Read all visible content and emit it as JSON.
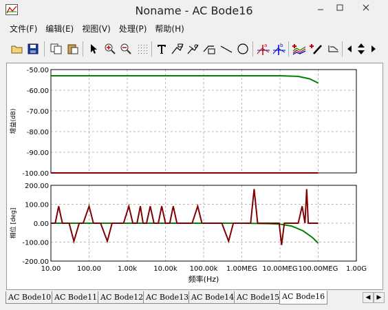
{
  "window": {
    "title": "Noname - AC Bode16"
  },
  "menu": [
    {
      "label": "文件(F)"
    },
    {
      "label": "编辑(E)"
    },
    {
      "label": "视图(V)"
    },
    {
      "label": "处理(P)"
    },
    {
      "label": "帮助(H)"
    }
  ],
  "toolbar": {
    "icons": [
      "open-icon",
      "save-icon",
      "copy-icon",
      "paste-icon",
      "pointer-icon",
      "zoom-in-icon",
      "zoom-out-icon",
      "grid-icon",
      "text-icon",
      "annotate-icon",
      "annotate-arrow-icon",
      "annotate-box-icon",
      "line-icon",
      "ellipse-icon",
      "cursor-a-icon",
      "cursor-b-icon",
      "add-trace-icon",
      "probe-icon",
      "legend-icon",
      "scroll-left-icon",
      "scroll-updown-icon",
      "scroll-right-icon"
    ]
  },
  "chart_data": [
    {
      "type": "line",
      "title": "",
      "xlabel": "",
      "ylabel": "增益(dB)",
      "xscale": "log",
      "xlim": [
        10,
        1000000000
      ],
      "ylim": [
        -100,
        -50
      ],
      "yticks": [
        "-50.00",
        "-60.00",
        "-70.00",
        "-80.00",
        "-90.00",
        "-100.00"
      ],
      "grid": true,
      "series": [
        {
          "color": "#008000",
          "x": [
            10,
            1000000,
            10000000,
            30000000,
            60000000,
            100000000
          ],
          "y": [
            -53,
            -53,
            -53,
            -53.3,
            -54.5,
            -56.5
          ]
        },
        {
          "color": "#800000",
          "x": [
            10,
            100000000
          ],
          "y": [
            -100,
            -100
          ]
        }
      ]
    },
    {
      "type": "line",
      "title": "",
      "xlabel": "频率(Hz)",
      "ylabel": "相位 [deg]",
      "xscale": "log",
      "xlim": [
        10,
        1000000000
      ],
      "ylim": [
        -200,
        200
      ],
      "yticks": [
        "200.00",
        "100.00",
        "0.00",
        "-100.00",
        "-200.00"
      ],
      "xticks": [
        "10.00",
        "100.00",
        "1.00k",
        "10.00k",
        "100.00k",
        "1.00MEG",
        "10.00MEG",
        "100.00MEG",
        "1.00G"
      ],
      "grid": true,
      "series": [
        {
          "color": "#008000",
          "x": [
            10,
            1000000,
            5000000,
            10000000,
            20000000,
            40000000,
            70000000,
            100000000
          ],
          "y": [
            0,
            0,
            -2,
            -5,
            -15,
            -40,
            -75,
            -105
          ]
        },
        {
          "color": "#800000",
          "x": [
            10,
            13,
            16,
            20,
            30,
            40,
            55,
            70,
            100,
            130,
            200,
            300,
            400,
            600,
            800,
            1100,
            1400,
            1800,
            2200,
            2600,
            3200,
            4000,
            5000,
            6500,
            8000,
            10000,
            13000,
            16000,
            20000,
            50000,
            70000,
            90000,
            120000,
            200000,
            300000,
            450000,
            600000,
            1000000,
            1700000,
            2100000,
            2600000,
            4000000,
            7000000,
            9500000,
            11000000,
            13000000,
            15000000,
            25000000,
            30000000,
            38000000,
            45000000,
            50000000,
            55000000,
            70000000,
            100000000
          ],
          "y": [
            0,
            0,
            90,
            0,
            0,
            -95,
            0,
            0,
            90,
            0,
            0,
            -95,
            0,
            0,
            0,
            90,
            0,
            0,
            90,
            0,
            0,
            90,
            0,
            0,
            90,
            0,
            0,
            90,
            0,
            0,
            90,
            0,
            0,
            0,
            0,
            -95,
            0,
            0,
            0,
            180,
            0,
            0,
            0,
            0,
            -115,
            0,
            0,
            0,
            0,
            90,
            0,
            180,
            0,
            0,
            0
          ]
        }
      ]
    }
  ],
  "tabs": [
    {
      "label": "AC Bode10"
    },
    {
      "label": "AC Bode11"
    },
    {
      "label": "AC Bode12"
    },
    {
      "label": "AC Bode13"
    },
    {
      "label": "AC Bode14"
    },
    {
      "label": "AC Bode15"
    },
    {
      "label": "AC Bode16"
    }
  ]
}
